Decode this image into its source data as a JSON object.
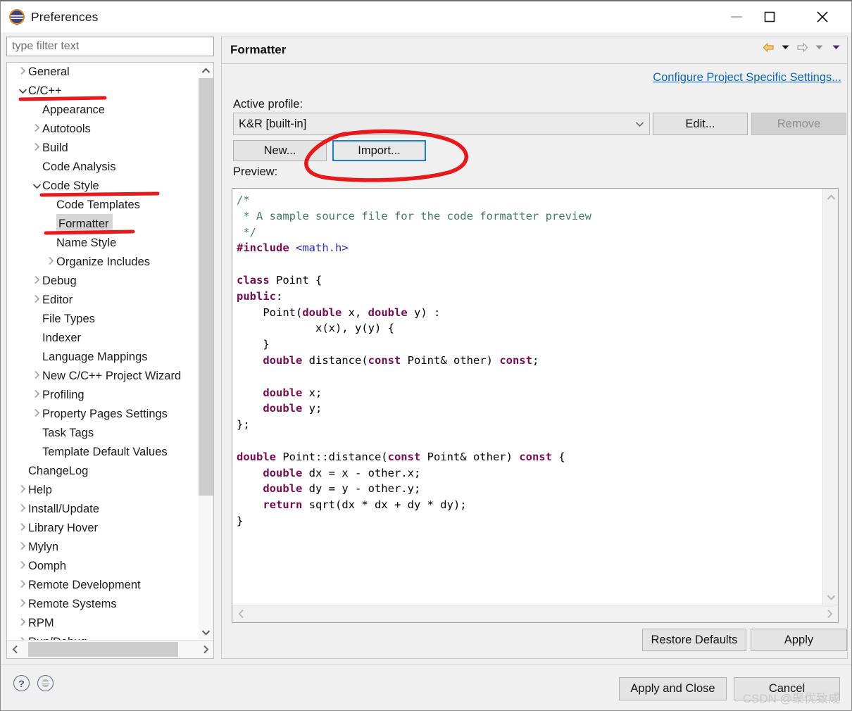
{
  "window": {
    "title": "Preferences",
    "app_icon": "eclipse-icon",
    "controls": {
      "minimize": "minimize-icon",
      "maximize": "maximize-icon",
      "close": "close-icon"
    }
  },
  "sidebar": {
    "filter_placeholder": "type filter text",
    "filter_value": "",
    "items": [
      {
        "label": "General",
        "indent": 0,
        "twisty": "collapsed",
        "selected": false
      },
      {
        "label": "C/C++",
        "indent": 0,
        "twisty": "expanded",
        "selected": false
      },
      {
        "label": "Appearance",
        "indent": 1,
        "twisty": "none",
        "selected": false
      },
      {
        "label": "Autotools",
        "indent": 1,
        "twisty": "collapsed",
        "selected": false
      },
      {
        "label": "Build",
        "indent": 1,
        "twisty": "collapsed",
        "selected": false
      },
      {
        "label": "Code Analysis",
        "indent": 1,
        "twisty": "none",
        "selected": false
      },
      {
        "label": "Code Style",
        "indent": 1,
        "twisty": "expanded",
        "selected": false
      },
      {
        "label": "Code Templates",
        "indent": 2,
        "twisty": "none",
        "selected": false
      },
      {
        "label": "Formatter",
        "indent": 2,
        "twisty": "none",
        "selected": true
      },
      {
        "label": "Name Style",
        "indent": 2,
        "twisty": "none",
        "selected": false
      },
      {
        "label": "Organize Includes",
        "indent": 2,
        "twisty": "collapsed",
        "selected": false
      },
      {
        "label": "Debug",
        "indent": 1,
        "twisty": "collapsed",
        "selected": false
      },
      {
        "label": "Editor",
        "indent": 1,
        "twisty": "collapsed",
        "selected": false
      },
      {
        "label": "File Types",
        "indent": 1,
        "twisty": "none",
        "selected": false
      },
      {
        "label": "Indexer",
        "indent": 1,
        "twisty": "none",
        "selected": false
      },
      {
        "label": "Language Mappings",
        "indent": 1,
        "twisty": "none",
        "selected": false
      },
      {
        "label": "New C/C++ Project Wizard",
        "indent": 1,
        "twisty": "collapsed",
        "selected": false
      },
      {
        "label": "Profiling",
        "indent": 1,
        "twisty": "collapsed",
        "selected": false
      },
      {
        "label": "Property Pages Settings",
        "indent": 1,
        "twisty": "collapsed",
        "selected": false
      },
      {
        "label": "Task Tags",
        "indent": 1,
        "twisty": "none",
        "selected": false
      },
      {
        "label": "Template Default Values",
        "indent": 1,
        "twisty": "none",
        "selected": false
      },
      {
        "label": "ChangeLog",
        "indent": 0,
        "twisty": "none",
        "selected": false
      },
      {
        "label": "Help",
        "indent": 0,
        "twisty": "collapsed",
        "selected": false
      },
      {
        "label": "Install/Update",
        "indent": 0,
        "twisty": "collapsed",
        "selected": false
      },
      {
        "label": "Library Hover",
        "indent": 0,
        "twisty": "collapsed",
        "selected": false
      },
      {
        "label": "Mylyn",
        "indent": 0,
        "twisty": "collapsed",
        "selected": false
      },
      {
        "label": "Oomph",
        "indent": 0,
        "twisty": "collapsed",
        "selected": false
      },
      {
        "label": "Remote Development",
        "indent": 0,
        "twisty": "collapsed",
        "selected": false
      },
      {
        "label": "Remote Systems",
        "indent": 0,
        "twisty": "collapsed",
        "selected": false
      },
      {
        "label": "RPM",
        "indent": 0,
        "twisty": "collapsed",
        "selected": false
      },
      {
        "label": "Run/Debug",
        "indent": 0,
        "twisty": "collapsed",
        "selected": false
      }
    ]
  },
  "page": {
    "title": "Formatter",
    "nav_icons": [
      "back-arrow-icon",
      "back-dropdown-icon",
      "forward-arrow-icon",
      "forward-dropdown-icon",
      "menu-dropdown-icon"
    ],
    "configure_link": "Configure Project Specific Settings...",
    "active_profile_label": "Active profile:",
    "active_profile_value": "K&R [built-in]",
    "buttons": {
      "edit": "Edit...",
      "remove": "Remove",
      "remove_enabled": false,
      "new": "New...",
      "import": "Import...",
      "import_focused": true,
      "restore_defaults": "Restore Defaults",
      "apply": "Apply"
    },
    "preview_label": "Preview:",
    "preview_code_lines": [
      "/*",
      " * A sample source file for the code formatter preview",
      " */",
      "#include <math.h>",
      "",
      "class Point {",
      "public:",
      "    Point(double x, double y) :",
      "            x(x), y(y) {",
      "    }",
      "    double distance(const Point& other) const;",
      "",
      "    double x;",
      "    double y;",
      "};",
      "",
      "double Point::distance(const Point& other) const {",
      "    double dx = x - other.x;",
      "    double dy = y - other.y;",
      "    return sqrt(dx * dx + dy * dy);",
      "}"
    ]
  },
  "footer": {
    "help_icon": "question-mark-icon",
    "secondary_icon": "eclipse-small-icon",
    "apply_and_close": "Apply and Close",
    "cancel": "Cancel",
    "watermark": "CSDN @聚优致成"
  },
  "annotations": {
    "color": "#e8191b",
    "underlines": [
      "C/C++",
      "Code Style",
      "Formatter"
    ],
    "circled_target": "Import..."
  },
  "colors": {
    "accent_link": "#0a66c2",
    "focus_border": "#1a7fd4",
    "annotation_red": "#e8191b",
    "selection_gray": "#d6d6d6",
    "code_comment": "#3f7f5f",
    "code_keyword": "#7a0b52",
    "code_include": "#2a2ad6"
  }
}
